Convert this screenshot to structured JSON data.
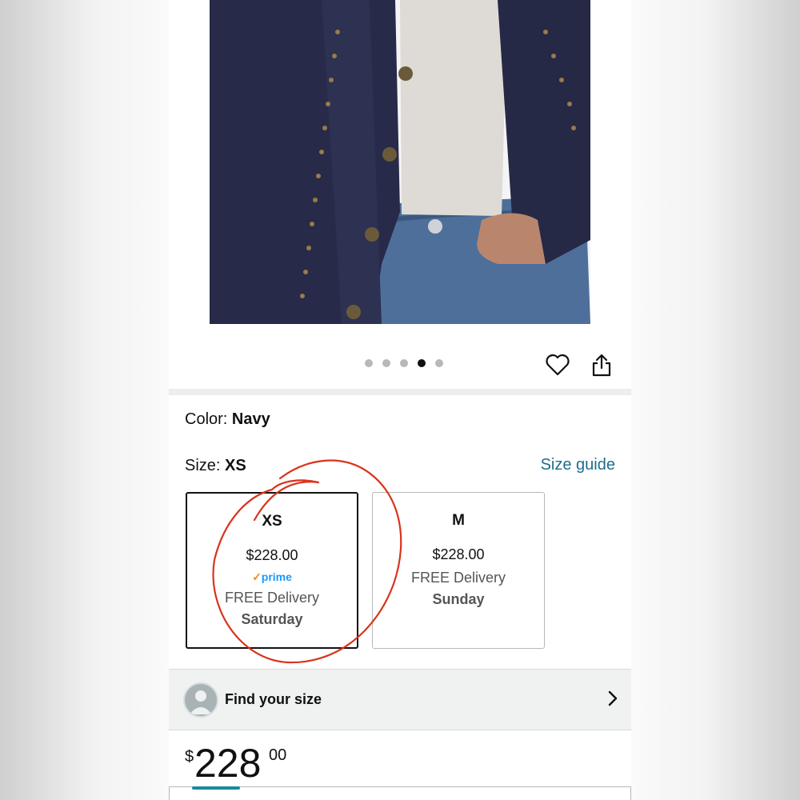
{
  "gallery": {
    "image_alt": "navy studded jacket",
    "dot_count": 5,
    "active_dot_index": 3
  },
  "actions": {
    "favorite_icon": "heart-icon",
    "share_icon": "share-icon"
  },
  "color": {
    "label": "Color:",
    "value": "Navy"
  },
  "size": {
    "label": "Size:",
    "value": "XS",
    "guide_link": "Size guide",
    "options": [
      {
        "size": "XS",
        "price": "$228.00",
        "prime_badge": "prime",
        "delivery": "FREE Delivery",
        "day": "Saturday",
        "selected": true
      },
      {
        "size": "M",
        "price": "$228.00",
        "prime_badge": "",
        "delivery": "FREE Delivery",
        "day": "Sunday",
        "selected": false
      }
    ]
  },
  "find_size": {
    "label": "Find your size",
    "icon": "avatar-icon",
    "chevron": "chevron-right-icon"
  },
  "price": {
    "symbol": "$",
    "whole": "228",
    "fraction": "00"
  },
  "colors": {
    "link": "#1f6c8c",
    "prime": "#1a98ff",
    "prime_check": "#f08a1c",
    "annotation": "#d8341c",
    "accent_bar": "#1a8aa0"
  }
}
